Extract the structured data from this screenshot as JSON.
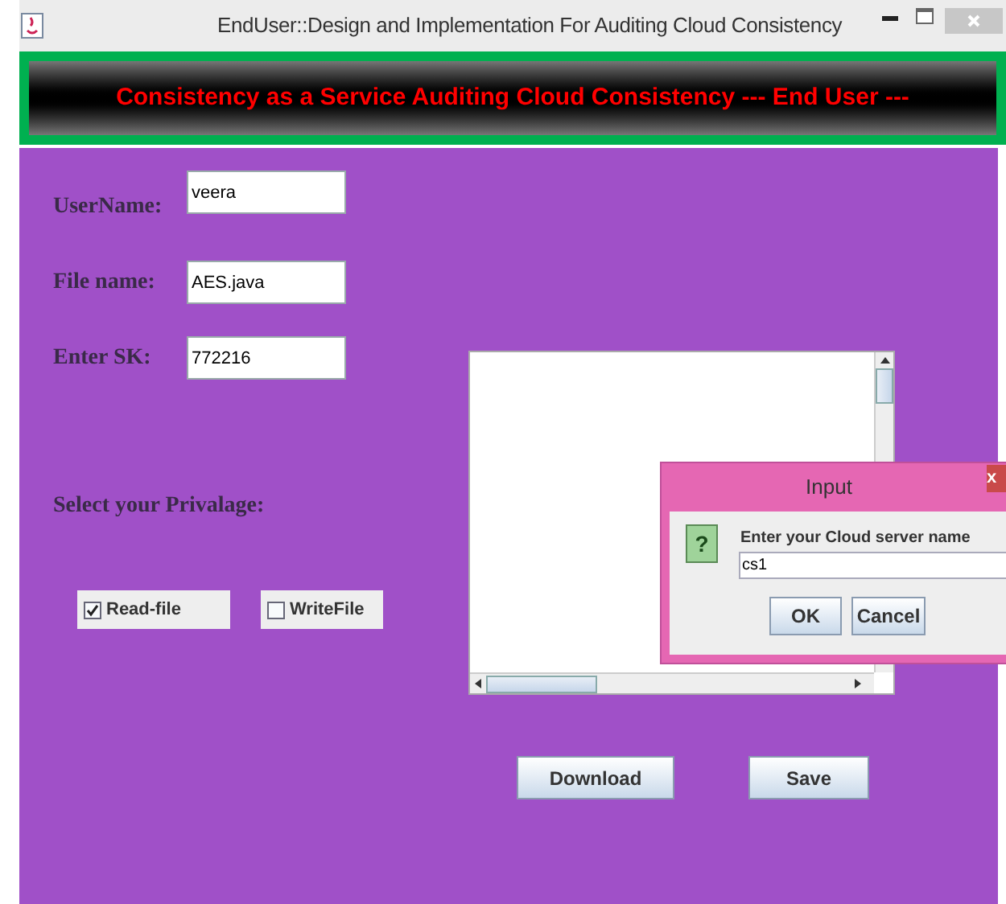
{
  "window": {
    "title": "EndUser::Design and Implementation For Auditing Cloud Consistency"
  },
  "banner": {
    "text": "Consistency as a Service Auditing Cloud Consistency --- End User ---"
  },
  "fields": [
    {
      "label": "UserName:",
      "value": "veera"
    },
    {
      "label": "File name:",
      "value": "AES.java"
    },
    {
      "label": "Enter SK:",
      "value": "772216"
    }
  ],
  "privilege": {
    "label": "Select your Privalage:",
    "options": [
      {
        "label": "Read-file",
        "checked": true
      },
      {
        "label": "WriteFile",
        "checked": false
      }
    ]
  },
  "buttons": [
    "Download",
    "Save"
  ],
  "dialog": {
    "title": "Input",
    "close": "x",
    "icon": "?",
    "prompt": "Enter your Cloud server name",
    "value": "cs1",
    "buttons": [
      "OK",
      "Cancel"
    ]
  }
}
